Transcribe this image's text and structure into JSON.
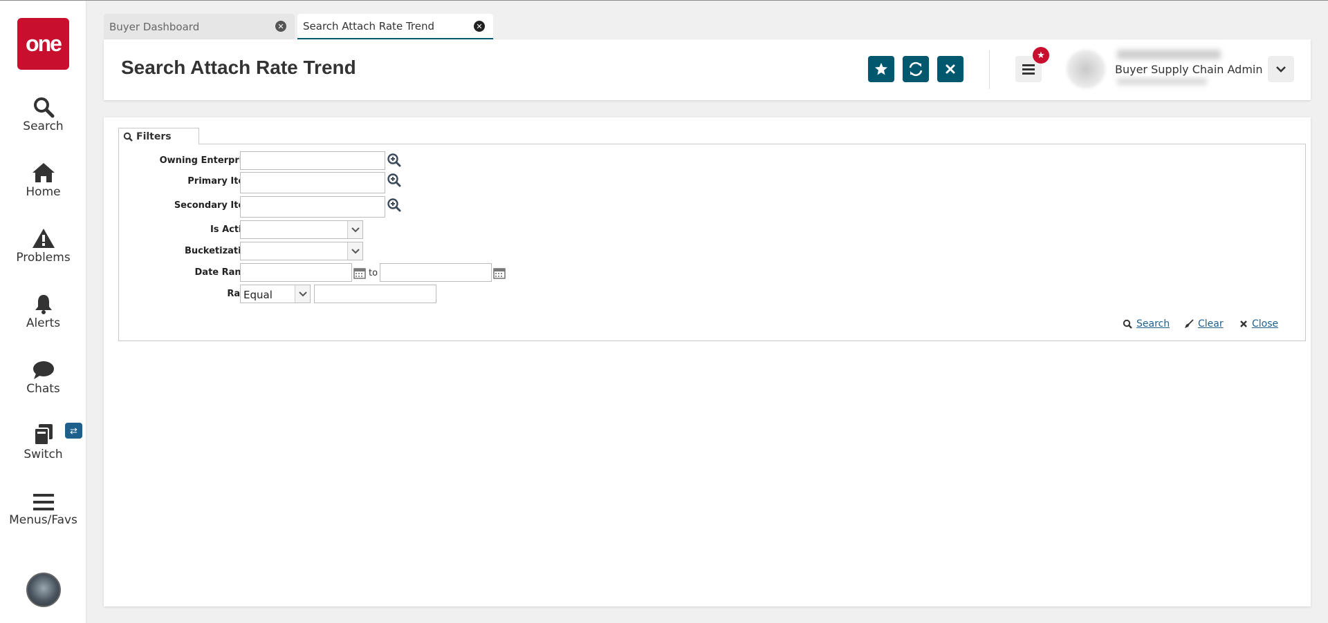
{
  "nav": {
    "logo_text": "one",
    "items": [
      {
        "label": "Search",
        "icon": "search-icon"
      },
      {
        "label": "Home",
        "icon": "home-icon"
      },
      {
        "label": "Problems",
        "icon": "warning-icon"
      },
      {
        "label": "Alerts",
        "icon": "bell-icon"
      },
      {
        "label": "Chats",
        "icon": "chat-icon"
      },
      {
        "label": "Switch",
        "icon": "switch-icon"
      },
      {
        "label": "Menus/Favs",
        "icon": "hamburger-icon"
      }
    ]
  },
  "tabs": [
    {
      "label": "Buyer Dashboard",
      "active": false
    },
    {
      "label": "Search Attach Rate Trend",
      "active": true
    }
  ],
  "header": {
    "title": "Search Attach Rate Trend",
    "user_role": "Buyer Supply Chain Admin"
  },
  "filters": {
    "tab_label": "Filters",
    "owning_enterprise_label": "Owning Enterprise:",
    "primary_item_label": "Primary Item:",
    "secondary_item_label": "Secondary Item:",
    "is_active_label": "Is Active:",
    "bucketization_label": "Bucketization:",
    "date_range_label": "Date Range:",
    "date_to_label": "to",
    "ratio_label": "Ratio:",
    "ratio_operator": "Equal",
    "search_label": "Search",
    "clear_label": "Clear",
    "close_label": "Close"
  },
  "colors": {
    "brand_red": "#c8102e",
    "accent_teal": "#00586e",
    "link_blue": "#1e5f8c"
  }
}
